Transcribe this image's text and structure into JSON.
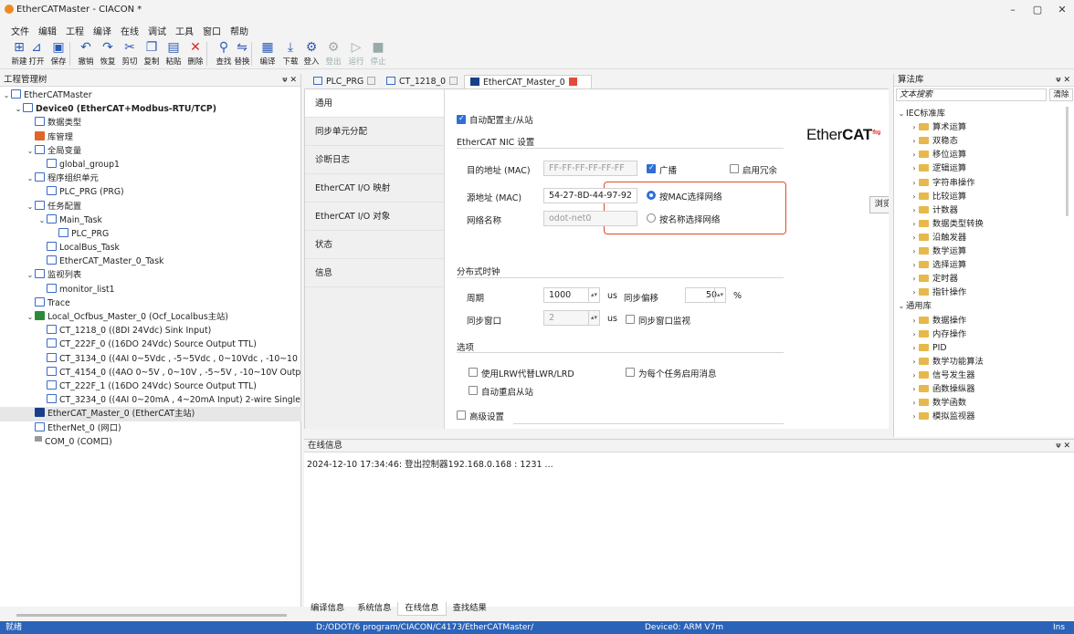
{
  "window": {
    "title": "EtherCATMaster - CIACON *",
    "minimize": "–",
    "maximize": "▢",
    "close": "✕"
  },
  "menu": [
    "文件",
    "编辑",
    "工程",
    "编译",
    "在线",
    "调试",
    "工具",
    "窗口",
    "帮助"
  ],
  "toolbar": [
    {
      "label": "新建",
      "icon": "new-file-icon",
      "glyph": "⊞",
      "enabled": true
    },
    {
      "label": "打开",
      "icon": "open-folder-icon",
      "glyph": "⊿",
      "enabled": true
    },
    {
      "label": "保存",
      "icon": "save-icon",
      "glyph": "▣",
      "enabled": true
    },
    {
      "label": "撤销",
      "icon": "undo-icon",
      "glyph": "↶",
      "enabled": true
    },
    {
      "label": "恢复",
      "icon": "redo-icon",
      "glyph": "↷",
      "enabled": true
    },
    {
      "label": "剪切",
      "icon": "scissors-icon",
      "glyph": "✂",
      "enabled": true
    },
    {
      "label": "复制",
      "icon": "copy-icon",
      "glyph": "❐",
      "enabled": true
    },
    {
      "label": "粘贴",
      "icon": "paste-icon",
      "glyph": "▤",
      "enabled": true
    },
    {
      "label": "删除",
      "icon": "delete-icon",
      "glyph": "✕",
      "enabled": true,
      "color": "#e02424"
    },
    {
      "label": "查找",
      "icon": "search-icon",
      "glyph": "⚲",
      "enabled": true
    },
    {
      "label": "替换",
      "icon": "replace-icon",
      "glyph": "⇋",
      "enabled": true
    },
    {
      "label": "编译",
      "icon": "compile-icon",
      "glyph": "▦",
      "enabled": true
    },
    {
      "label": "下载",
      "icon": "download-icon",
      "glyph": "⤓",
      "enabled": true
    },
    {
      "label": "登入",
      "icon": "login-icon",
      "glyph": "⚙",
      "enabled": true
    },
    {
      "label": "登出",
      "icon": "logout-icon",
      "glyph": "⚙",
      "enabled": false
    },
    {
      "label": "运行",
      "icon": "run-icon",
      "glyph": "▷",
      "enabled": false
    },
    {
      "label": "停止",
      "icon": "stop-icon",
      "glyph": "■",
      "enabled": false
    }
  ],
  "project_panel": {
    "title": "工程管理树",
    "pin": "ᴪ ✕"
  },
  "tree": [
    {
      "indent": 0,
      "chev": "⌄",
      "icon": "project-icon",
      "text": "EtherCATMaster",
      "bold": false
    },
    {
      "indent": 1,
      "chev": "⌄",
      "icon": "device-icon",
      "text": "Device0 (EtherCAT+Modbus-RTU/TCP)",
      "bold": true
    },
    {
      "indent": 2,
      "chev": "",
      "icon": "datatype-icon",
      "text": "数据类型",
      "bold": false
    },
    {
      "indent": 2,
      "chev": "",
      "icon": "library-icon",
      "text": "库管理",
      "bold": false
    },
    {
      "indent": 2,
      "chev": "⌄",
      "icon": "global-var-icon",
      "text": "全局变量",
      "bold": false
    },
    {
      "indent": 3,
      "chev": "",
      "icon": "table-icon",
      "text": "global_group1",
      "bold": false
    },
    {
      "indent": 2,
      "chev": "⌄",
      "icon": "program-unit-icon",
      "text": "程序组织单元",
      "bold": false
    },
    {
      "indent": 3,
      "chev": "",
      "icon": "prg-icon",
      "text": "PLC_PRG (PRG)",
      "bold": false
    },
    {
      "indent": 2,
      "chev": "⌄",
      "icon": "task-config-icon",
      "text": "任务配置",
      "bold": false
    },
    {
      "indent": 3,
      "chev": "⌄",
      "icon": "task-icon",
      "text": "Main_Task",
      "bold": false
    },
    {
      "indent": 4,
      "chev": "",
      "icon": "prg-call-icon",
      "text": "PLC_PRG",
      "bold": false
    },
    {
      "indent": 3,
      "chev": "",
      "icon": "task-icon",
      "text": "LocalBus_Task",
      "bold": false
    },
    {
      "indent": 3,
      "chev": "",
      "icon": "task-icon",
      "text": "EtherCAT_Master_0_Task",
      "bold": false
    },
    {
      "indent": 2,
      "chev": "⌄",
      "icon": "watch-list-icon",
      "text": "监视列表",
      "bold": false
    },
    {
      "indent": 3,
      "chev": "",
      "icon": "table-icon",
      "text": "monitor_list1",
      "bold": false
    },
    {
      "indent": 2,
      "chev": "",
      "icon": "trace-icon",
      "text": "Trace",
      "bold": false
    },
    {
      "indent": 2,
      "chev": "⌄",
      "icon": "localbus-icon",
      "text": "Local_Ocfbus_Master_0 (Ocf_Localbus主站)",
      "bold": false
    },
    {
      "indent": 3,
      "chev": "",
      "icon": "io-module-icon",
      "text": "CT_1218_0 ((8DI 24Vdc) Sink Input)",
      "bold": false
    },
    {
      "indent": 3,
      "chev": "",
      "icon": "io-module-icon",
      "text": "CT_222F_0 ((16DO 24Vdc) Source Output TTL)",
      "bold": false
    },
    {
      "indent": 3,
      "chev": "",
      "icon": "io-module-icon",
      "text": "CT_3134_0 ((4AI 0~5Vdc , -5~5Vdc , 0~10Vdc , -10~10",
      "bold": false
    },
    {
      "indent": 3,
      "chev": "",
      "icon": "io-module-icon",
      "text": "CT_4154_0 ((4AO 0~5V , 0~10V , -5~5V , -10~10V Outp",
      "bold": false
    },
    {
      "indent": 3,
      "chev": "",
      "icon": "io-module-icon",
      "text": "CT_222F_1 ((16DO 24Vdc) Source Output TTL)",
      "bold": false
    },
    {
      "indent": 3,
      "chev": "",
      "icon": "io-module-icon",
      "text": "CT_3234_0 ((4AI 0~20mA , 4~20mA Input) 2-wire Single",
      "bold": false
    },
    {
      "indent": 2,
      "chev": "",
      "icon": "ethercat-master-icon",
      "text": "EtherCAT_Master_0 (EtherCAT主站)",
      "bold": false,
      "selected": true
    },
    {
      "indent": 2,
      "chev": "",
      "icon": "ethernet-icon",
      "text": "EtherNet_0 (网口)",
      "bold": false
    },
    {
      "indent": 2,
      "chev": "",
      "icon": "com-port-icon",
      "text": "COM_0 (COM口)",
      "bold": false
    }
  ],
  "tabs": [
    {
      "label": "PLC_PRG",
      "icon": "prg-tab-icon"
    },
    {
      "label": "CT_1218_0",
      "icon": "module-tab-icon"
    },
    {
      "label": "EtherCAT_Master_0",
      "icon": "ethercat-tab-icon",
      "active": true
    }
  ],
  "vtabs": [
    "通用",
    "同步单元分配",
    "诊断日志",
    "EtherCAT I/O 映射",
    "EtherCAT I/O 对象",
    "状态",
    "信息"
  ],
  "form": {
    "auto_config": "自动配置主/从站",
    "logo_plain": "Ether",
    "logo_bold": "CAT",
    "nic_section": "EtherCAT NIC 设置",
    "dest_label": "目的地址 (MAC)",
    "dest_value": "FF-FF-FF-FF-FF-FF",
    "broadcast": "广播",
    "redundancy": "启用冗余",
    "src_label": "源地址 (MAC)",
    "src_value": "54-27-8D-44-97-92",
    "by_mac": "按MAC选择网络",
    "browse": "浏览...",
    "netname_label": "网络名称",
    "netname_value": "odot-net0",
    "by_name": "按名称选择网络",
    "dc_section": "分布式时钟",
    "period_label": "周期",
    "period_value": "1000",
    "period_unit": "us",
    "sync_offset_label": "同步偏移",
    "sync_offset_value": "50",
    "sync_offset_unit": "%",
    "sync_window_label": "同步窗口",
    "sync_window_value": "2",
    "sync_window_unit": "us",
    "sync_window_monitor": "同步窗口监视",
    "options_section": "选项",
    "use_lrw": "使用LRW代替LWR/LRD",
    "per_task_msg": "为每个任务启用消息",
    "auto_restart": "自动重启从站",
    "advanced": "高级设置"
  },
  "online_panel": {
    "title": "在线信息",
    "pin": "ᴪ ✕",
    "message": "2024-12-10 17:34:46: 登出控制器192.168.0.168 : 1231 ..."
  },
  "bottom_tabs": [
    "编译信息",
    "系统信息",
    "在线信息",
    "查找结果"
  ],
  "lib_panel": {
    "title": "算法库",
    "pin": "ᴪ ✕",
    "search_placeholder": "文本搜索",
    "clear": "清除"
  },
  "lib_tree": [
    {
      "indent": 0,
      "chev": "⌄",
      "folder": false,
      "text": "IEC标准库"
    },
    {
      "indent": 1,
      "chev": "›",
      "folder": true,
      "text": "算术运算"
    },
    {
      "indent": 1,
      "chev": "›",
      "folder": true,
      "text": "双稳态"
    },
    {
      "indent": 1,
      "chev": "›",
      "folder": true,
      "text": "移位运算"
    },
    {
      "indent": 1,
      "chev": "›",
      "folder": true,
      "text": "逻辑运算"
    },
    {
      "indent": 1,
      "chev": "›",
      "folder": true,
      "text": "字符串操作"
    },
    {
      "indent": 1,
      "chev": "›",
      "folder": true,
      "text": "比较运算"
    },
    {
      "indent": 1,
      "chev": "›",
      "folder": true,
      "text": "计数器"
    },
    {
      "indent": 1,
      "chev": "›",
      "folder": true,
      "text": "数据类型转换"
    },
    {
      "indent": 1,
      "chev": "›",
      "folder": true,
      "text": "沿触发器"
    },
    {
      "indent": 1,
      "chev": "›",
      "folder": true,
      "text": "数学运算"
    },
    {
      "indent": 1,
      "chev": "›",
      "folder": true,
      "text": "选择运算"
    },
    {
      "indent": 1,
      "chev": "›",
      "folder": true,
      "text": "定时器"
    },
    {
      "indent": 1,
      "chev": "›",
      "folder": true,
      "text": "指针操作"
    },
    {
      "indent": 0,
      "chev": "⌄",
      "folder": false,
      "text": "通用库"
    },
    {
      "indent": 1,
      "chev": "›",
      "folder": true,
      "text": "数据操作"
    },
    {
      "indent": 1,
      "chev": "›",
      "folder": true,
      "text": "内存操作"
    },
    {
      "indent": 1,
      "chev": "›",
      "folder": true,
      "text": "PID"
    },
    {
      "indent": 1,
      "chev": "›",
      "folder": true,
      "text": "数学功能算法"
    },
    {
      "indent": 1,
      "chev": "›",
      "folder": true,
      "text": "信号发生器"
    },
    {
      "indent": 1,
      "chev": "›",
      "folder": true,
      "text": "函数操纵器"
    },
    {
      "indent": 1,
      "chev": "›",
      "folder": true,
      "text": "数学函数"
    },
    {
      "indent": 1,
      "chev": "›",
      "folder": true,
      "text": "模拟监视器"
    }
  ],
  "status": {
    "state": "就绪",
    "path": "D:/ODOT/6 program/CIACON/C4173/EtherCATMaster/",
    "device": "Device0: ARM V7m",
    "mode": "Ins"
  },
  "colors": {
    "accent": "#2f6fd6",
    "statusbar": "#2a63b8",
    "highlight_box": "#e04a2a"
  }
}
